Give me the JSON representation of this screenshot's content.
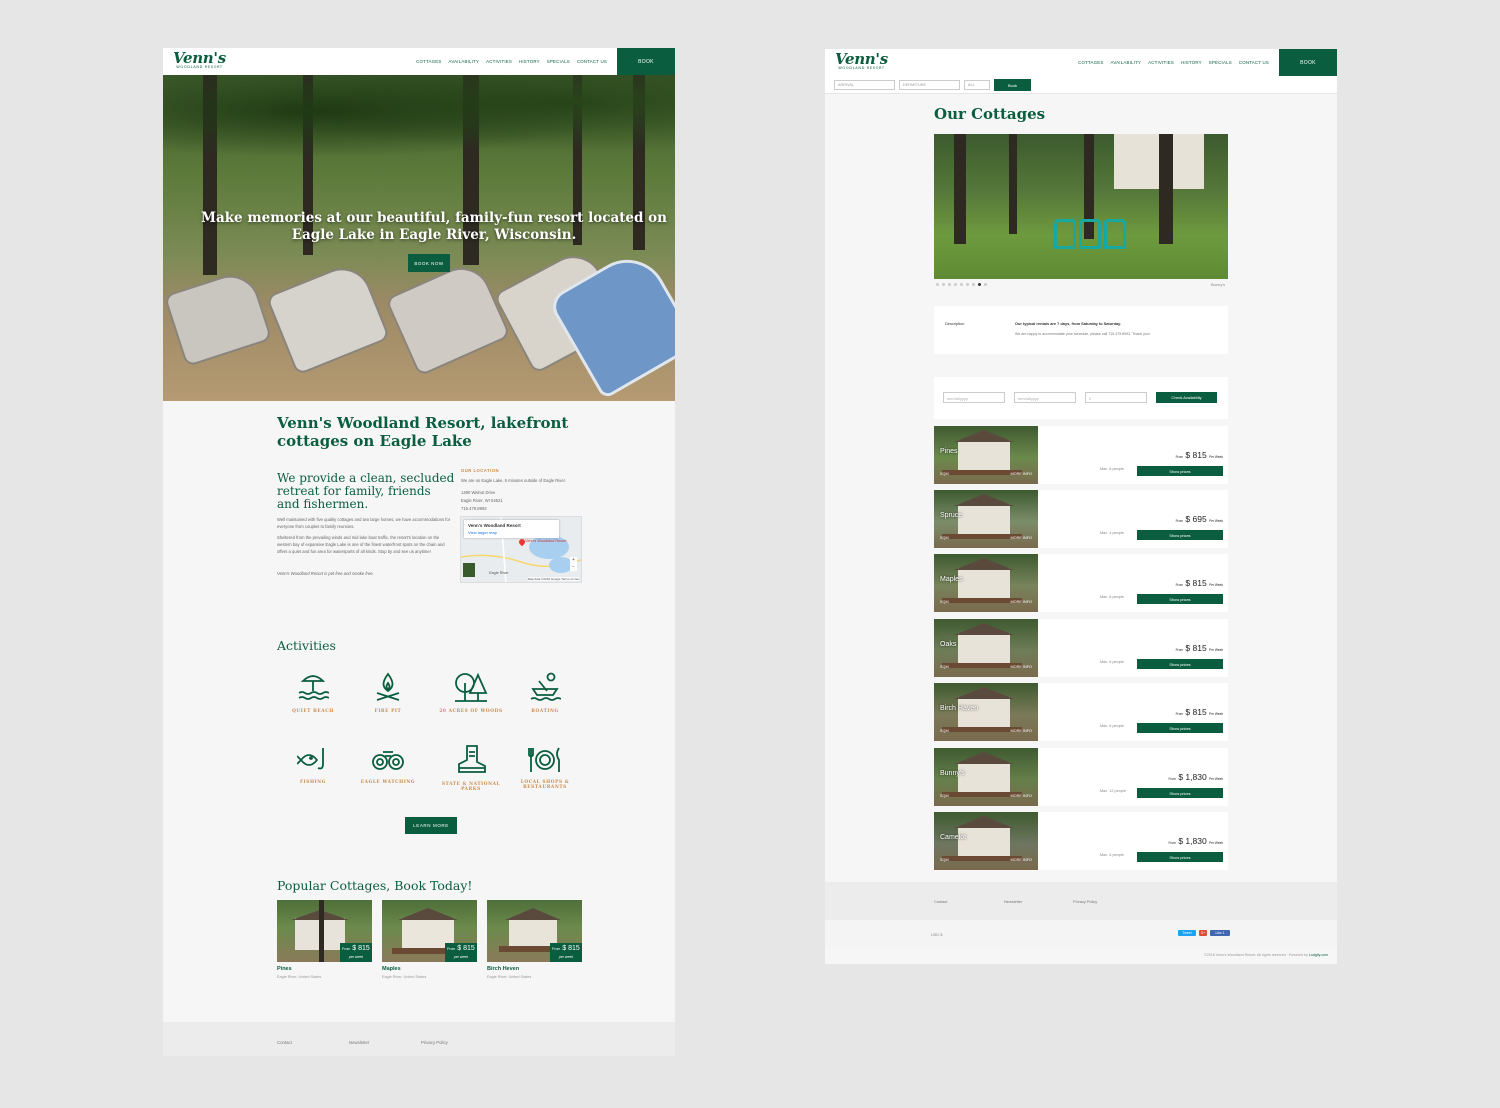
{
  "left_page": {
    "logo": {
      "main": "Venn's",
      "sub": "WOODLAND RESORT"
    },
    "nav": [
      "COTTAGES",
      "AVAILABILITY",
      "ACTIVITIES",
      "HISTORY",
      "SPECIALS",
      "CONTACT US"
    ],
    "book_label": "BOOK",
    "hero": {
      "headline": "Make memories at our beautiful, family-fun resort located on Eagle Lake in Eagle River, Wisconsin.",
      "button": "BOOK NOW"
    },
    "about": {
      "title": "Venn's Woodland Resort, lakefront cottages on Eagle Lake",
      "lead": "We provide a clean, secluded retreat for family, friends and fishermen.",
      "p1": "Well maintained with five quality cottages and two large homes, we have accommodations for everyone from couples to family reunions.",
      "p2": "Sheltered from the prevailing winds and mid lake boat traffic, the resort's location on the western bay of expansive Eagle Lake is one of the finest waterfront spots on the chain and offers a quiet and fun area for watersports of all kinds. Stop by and see us anytime!",
      "p3": "Venn's Woodland Resort is pet free and smoke free."
    },
    "location": {
      "label": "OUR LOCATION",
      "intro": "We are on Eagle Lake, 5 minutes outside of Eagle River.",
      "address1": "1490 Walnut Drive",
      "address2": "Eagle River, WI 54521",
      "phone": "715.479.8993",
      "map_title": "Venn's Woodland Resort",
      "map_link": "View larger map",
      "map_pin_label": "Venn's Woodland Resort",
      "map_town": "Eagle River",
      "map_credit": "Map data ©2018 Google   Terms of Use"
    },
    "activities": {
      "title": "Activities",
      "items": [
        {
          "label": "QUIET BEACH",
          "icon": "beach-icon"
        },
        {
          "label": "FIRE PIT",
          "icon": "campfire-icon"
        },
        {
          "label": "20 ACRES OF WOODS",
          "icon": "trees-icon"
        },
        {
          "label": "BOATING",
          "icon": "canoe-icon"
        },
        {
          "label": "FISHING",
          "icon": "fish-icon"
        },
        {
          "label": "EAGLE WATCHING",
          "icon": "binoculars-icon"
        },
        {
          "label": "STATE & NATIONAL PARKS",
          "icon": "hiking-boot-icon"
        },
        {
          "label": "LOCAL SHOPS & RESTAURANTS",
          "icon": "dining-icon"
        }
      ],
      "button": "LEARN MORE"
    },
    "popular": {
      "title": "Popular Cottages, Book Today!",
      "cards": [
        {
          "name": "Pines",
          "location": "Eagle River, United States",
          "from": "From",
          "price": "$ 815",
          "per": "per week"
        },
        {
          "name": "Maples",
          "location": "Eagle River, United States",
          "from": "From",
          "price": "$ 815",
          "per": "per week"
        },
        {
          "name": "Birch Heven",
          "location": "Eagle River, United States",
          "from": "From",
          "price": "$ 815",
          "per": "per week"
        }
      ]
    },
    "footer": [
      "Contact",
      "Newsletter",
      "Privacy Policy"
    ]
  },
  "right_page": {
    "logo": {
      "main": "Venn's",
      "sub": "WOODLAND RESORT"
    },
    "nav": [
      "COTTAGES",
      "AVAILABILITY",
      "ACTIVITIES",
      "HISTORY",
      "SPECIALS",
      "CONTACT US"
    ],
    "book_label": "BOOK",
    "search": {
      "arrival": "ARRIVAL",
      "departure": "DEPARTURE",
      "guests": "ALL",
      "button": "Book"
    },
    "title": "Our Cottages",
    "slider": {
      "caption": "Bunny's",
      "dots": 9,
      "active_dot": 7
    },
    "description": {
      "key": "Description",
      "line1": "Our typical rentals are 7 days, from Saturday to Saturday.",
      "line2": "We are happy to accommodate your schedule, please call 715.479.8993. Thank you!"
    },
    "availability": {
      "date1": "mm/dd/yyyy",
      "date2": "mm/dd/yyyy",
      "guests": "2",
      "button": "Check Availability"
    },
    "cottages": [
      {
        "name": "Pines",
        "sqm": "SQM",
        "more": "MORE INFO",
        "max": "Max. 6 people",
        "from": "From",
        "price": "$ 815",
        "per": "Per Week",
        "button": "Show prices"
      },
      {
        "name": "Spruce",
        "sqm": "SQM",
        "more": "MORE INFO",
        "max": "Max. 4 people",
        "from": "From",
        "price": "$ 695",
        "per": "Per Week",
        "button": "Show prices"
      },
      {
        "name": "Maples",
        "sqm": "SQM",
        "more": "MORE INFO",
        "max": "Max. 6 people",
        "from": "From",
        "price": "$ 815",
        "per": "Per Week",
        "button": "Show prices"
      },
      {
        "name": "Oaks",
        "sqm": "SQM",
        "more": "MORE INFO",
        "max": "Max. 6 people",
        "from": "From",
        "price": "$ 815",
        "per": "Per Week",
        "button": "Show prices"
      },
      {
        "name": "Birch Haven",
        "sqm": "SQM",
        "more": "MORE INFO",
        "max": "Max. 6 people",
        "from": "From",
        "price": "$ 815",
        "per": "Per Week",
        "button": "Show prices"
      },
      {
        "name": "Bunny's",
        "sqm": "SQM",
        "more": "MORE INFO",
        "max": "Max. 12 people",
        "from": "From",
        "price": "$ 1,830",
        "per": "Per Week",
        "button": "Show prices"
      },
      {
        "name": "Camelot",
        "sqm": "SQM",
        "more": "MORE INFO",
        "max": "Max. 6 people",
        "from": "From",
        "price": "$ 1,830",
        "per": "Per Week",
        "button": "Show prices"
      }
    ],
    "footer": [
      "Contact",
      "Newsletter",
      "Privacy Policy"
    ],
    "currency": "USD $",
    "social": {
      "tweet": "Tweet",
      "gplus": "G+",
      "like": "Like 1"
    },
    "copyright": "©2018 Venn's Woodland Resort. All rights reserved · Powered by",
    "powered": "Lodgify.com"
  }
}
